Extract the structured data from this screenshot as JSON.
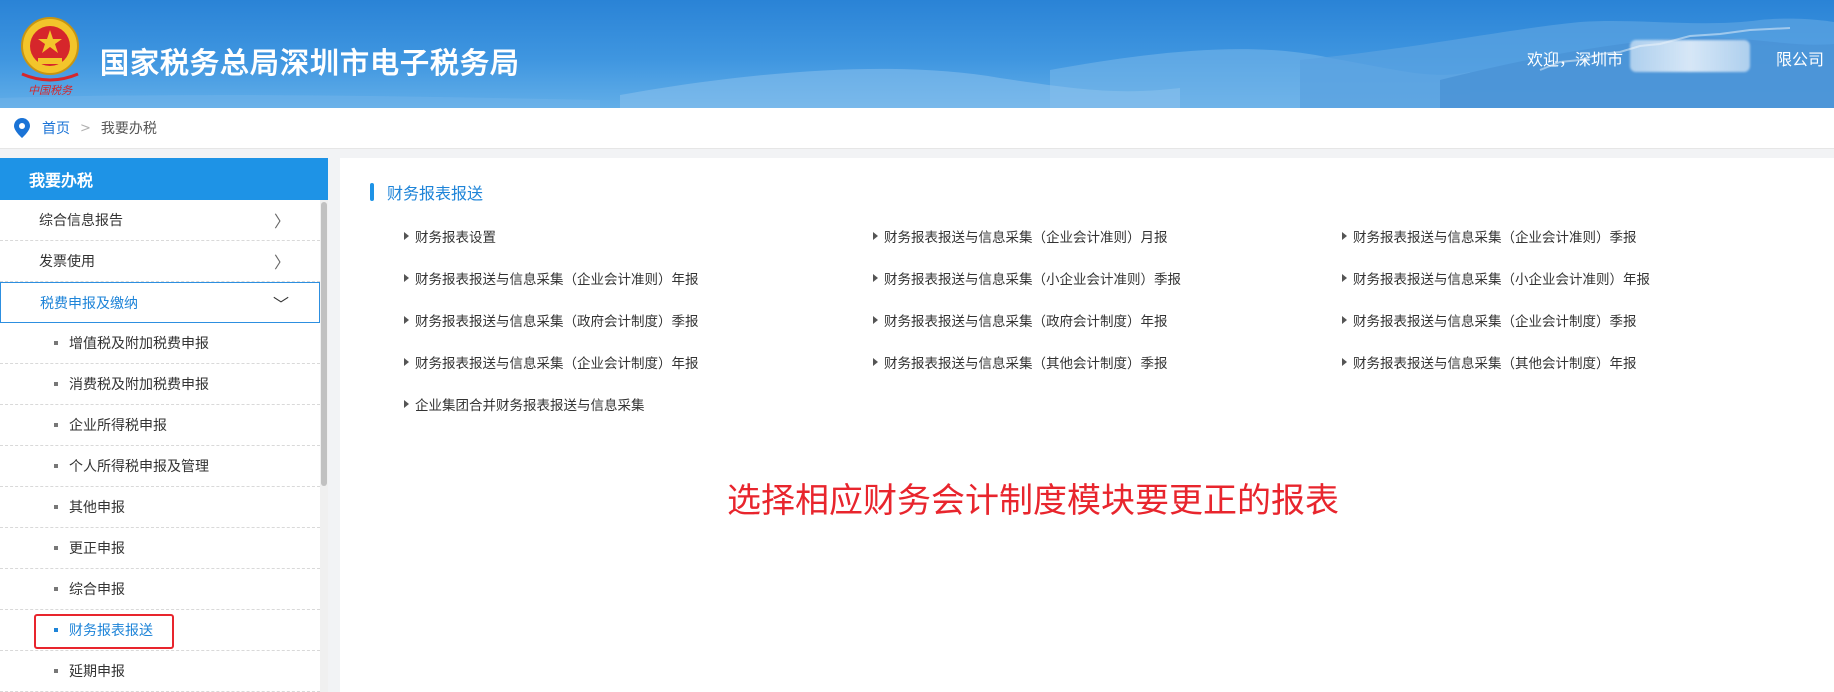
{
  "header": {
    "title": "国家税务总局深圳市电子税务局",
    "welcome_prefix": "欢迎，深圳市",
    "welcome_suffix": "限公司",
    "emblem_caption": "中国税务"
  },
  "breadcrumb": {
    "home": "首页",
    "separator": ">",
    "current": "我要办税"
  },
  "sidebar": {
    "title": "我要办税",
    "groups": [
      {
        "label": "综合信息报告",
        "arrow": "〉"
      },
      {
        "label": "发票使用",
        "arrow": "〉"
      },
      {
        "label": "税费申报及缴纳",
        "arrow": "﹀"
      }
    ],
    "sub_items": [
      {
        "label": "增值税及附加税费申报"
      },
      {
        "label": "消费税及附加税费申报"
      },
      {
        "label": "企业所得税申报"
      },
      {
        "label": "个人所得税申报及管理"
      },
      {
        "label": "其他申报"
      },
      {
        "label": "更正申报"
      },
      {
        "label": "综合申报"
      },
      {
        "label": "财务报表报送"
      },
      {
        "label": "延期申报"
      }
    ]
  },
  "main": {
    "section_title": "财务报表报送",
    "links": [
      "财务报表设置",
      "财务报表报送与信息采集（企业会计准则）月报",
      "财务报表报送与信息采集（企业会计准则）季报",
      "财务报表报送与信息采集（企业会计准则）年报",
      "财务报表报送与信息采集（小企业会计准则）季报",
      "财务报表报送与信息采集（小企业会计准则）年报",
      "财务报表报送与信息采集（政府会计制度）季报",
      "财务报表报送与信息采集（政府会计制度）年报",
      "财务报表报送与信息采集（企业会计制度）季报",
      "财务报表报送与信息采集（企业会计制度）年报",
      "财务报表报送与信息采集（其他会计制度）季报",
      "财务报表报送与信息采集（其他会计制度）年报",
      "企业集团合并财务报表报送与信息采集"
    ],
    "annotation": "选择相应财务会计制度模块要更正的报表"
  },
  "colors": {
    "accent": "#1e93e6",
    "link_active": "#1e84d8",
    "annotation": "#e8252d"
  }
}
